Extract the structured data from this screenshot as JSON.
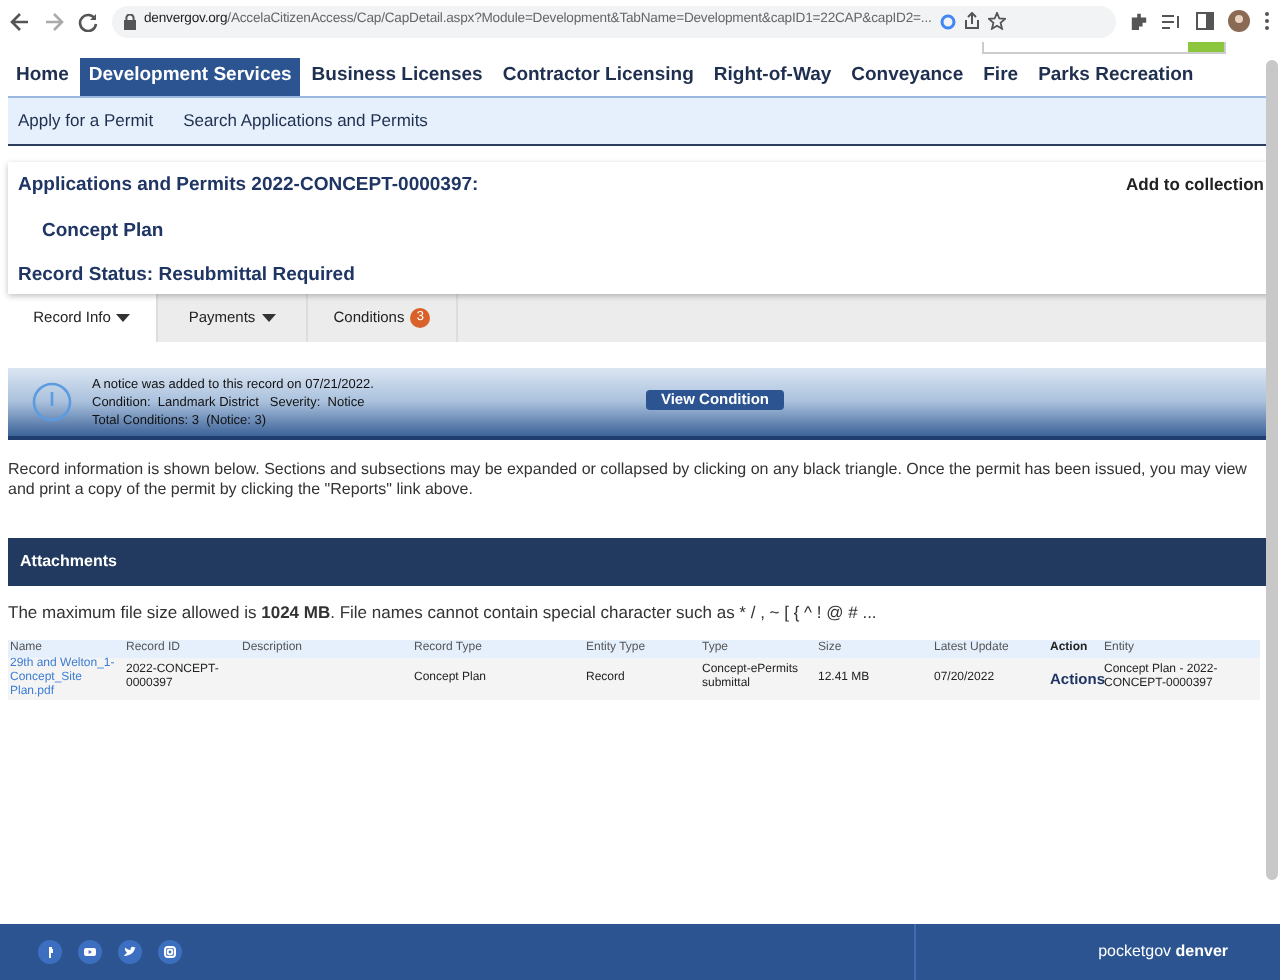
{
  "browser": {
    "url_domain": "denvergov.org",
    "url_path": "/AccelaCitizenAccess/Cap/CapDetail.aspx?Module=Development&TabName=Development&capID1=22CAP&capID2=..."
  },
  "nav": [
    {
      "label": "Home",
      "selected": false
    },
    {
      "label": "Development Services",
      "selected": true
    },
    {
      "label": "Business Licenses",
      "selected": false
    },
    {
      "label": "Contractor Licensing",
      "selected": false
    },
    {
      "label": "Right-of-Way",
      "selected": false
    },
    {
      "label": "Conveyance",
      "selected": false
    },
    {
      "label": "Fire",
      "selected": false
    },
    {
      "label": "Parks Recreation",
      "selected": false
    }
  ],
  "subnav": [
    "Apply for a Permit",
    "Search Applications and Permits"
  ],
  "record": {
    "title": "Applications and Permits 2022-CONCEPT-0000397:",
    "add_link": "Add to collection",
    "type": "Concept Plan",
    "status": "Record Status: Resubmittal Required"
  },
  "tabs": [
    {
      "label": "Record Info",
      "selected": true,
      "dropdown": true
    },
    {
      "label": "Payments",
      "selected": false,
      "dropdown": true
    },
    {
      "label": "Conditions",
      "selected": false,
      "badge": "3"
    }
  ],
  "notice": {
    "lines": [
      "A notice was added to this record on 07/21/2022.",
      "Condition:  Landmark District   Severity:  Notice",
      "Total Conditions: 3  (Notice: 3)"
    ],
    "button": "View Condition"
  },
  "info": "Record information is shown below. Sections and subsections may be expanded or collapsed by clicking on any black triangle. Once the permit has been issued, you may view and print a copy of the permit by clicking the \"Reports\" link above.",
  "attachments": {
    "title": "Attachments",
    "note": "The maximum file size allowed is **1024 MB**. File names cannot contain special character such as * / , ~ [ { ^ ! @ # ...",
    "columns": [
      "Name",
      "Record ID",
      "Description",
      "Record Type",
      "Entity Type",
      "Type",
      "Size",
      "Latest Update",
      "Action",
      "Entity"
    ],
    "rows": [
      {
        "name": "29th and Welton_1-Concept_Site Plan.pdf",
        "record_id": "2022-CONCEPT-0000397",
        "record_type": "Concept Plan",
        "entity_type": "Record",
        "type": "Concept-ePermits submittal",
        "size": "12.41 MB",
        "latest_update": "07/20/2022",
        "action": "Actions",
        "entity": "Concept Plan - 2022-CONCEPT-0000397"
      }
    ]
  },
  "footer": {
    "brand": "pocketgov **denver**"
  }
}
